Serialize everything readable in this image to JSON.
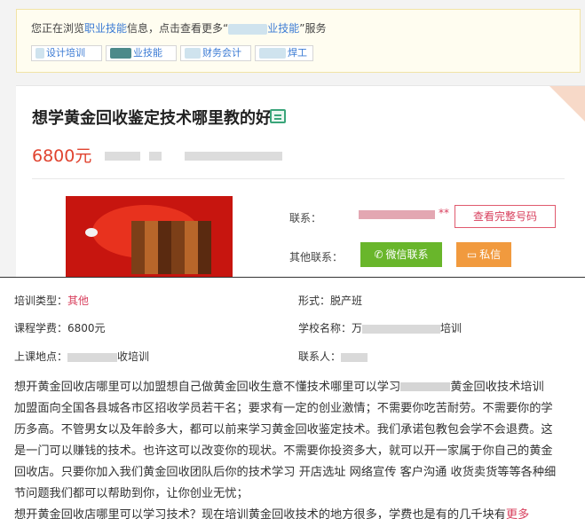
{
  "notice": {
    "prefix": "您正在浏览",
    "highlight": "职业技能",
    "middle": "信息，点击查看更多“",
    "highlight2": "业技能",
    "suffix": "”服务"
  },
  "tags": [
    "设计培训",
    "业技能",
    "财务会计",
    "焊工"
  ],
  "listing": {
    "title": "想学黄金回收鉴定技术哪里教的好",
    "price": "6800元",
    "contact_label": "联系：",
    "contact_tail": "**",
    "view_full_number": "查看完整号码",
    "other_contact_label": "其他联系：",
    "wechat_button": "微信联系",
    "message_button": "私信"
  },
  "details": {
    "type_label": "培训类型：",
    "type_value": "其他",
    "form_label": "形式：",
    "form_value": "脱产班",
    "fee_label": "课程学费：",
    "fee_value": "6800元",
    "school_label": "学校名称：",
    "school_prefix": "万",
    "school_suffix": "培训",
    "location_label": "上课地点：",
    "location_suffix": "收培训",
    "contact_person_label": "联系人："
  },
  "description": {
    "line1_a": "想开黄金回收店哪里可以加盟想自己做黄金回收生意不懂技术哪里可以学习",
    "line1_b": "黄金回收技术培训",
    "line2": "加盟面向全国各县城各市区招收学员若干名；要求有一定的创业激情；不需要你吃苦耐劳。不需要你的学",
    "line3": "历多高。不管男女以及年龄多大，都可以前来学习黄金回收鉴定技术。我们承诺包教包会学不会退费。这",
    "line4": "是一门可以赚钱的技术。也许这可以改变你的现状。不需要你投资多大，就可以开一家属于你自己的黄金",
    "line5": "回收店。只要你加入我们黄金回收团队后你的技术学习 开店选址 网络宣传 客户沟通 收货卖货等等各种细",
    "line6": "节问题我们都可以帮助到你，让你创业无忧；",
    "line7": "想开黄金回收店哪里可以学习技术？现在培训黄金回收技术的地方很多，学费也是有的几千块有",
    "more": "更多"
  },
  "colors": {
    "link_blue": "#3b7bd4",
    "price_red": "#e0432f",
    "accent_pink": "#d8405e",
    "wechat_green": "#69b62b",
    "message_orange": "#f19a3e"
  },
  "icons": {
    "certificate": "certificate-icon",
    "wechat": "wechat-icon",
    "message": "message-icon"
  }
}
